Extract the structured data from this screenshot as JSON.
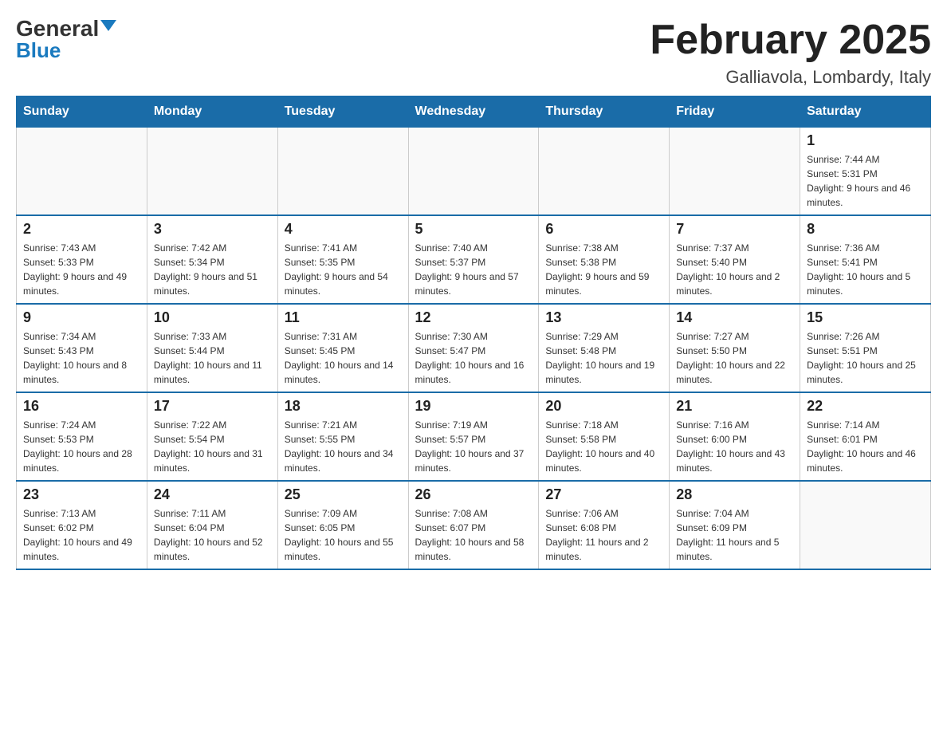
{
  "header": {
    "logo_general": "General",
    "logo_blue": "Blue",
    "month_title": "February 2025",
    "location": "Galliavola, Lombardy, Italy"
  },
  "days_of_week": [
    "Sunday",
    "Monday",
    "Tuesday",
    "Wednesday",
    "Thursday",
    "Friday",
    "Saturday"
  ],
  "weeks": [
    [
      {
        "day": "",
        "info": ""
      },
      {
        "day": "",
        "info": ""
      },
      {
        "day": "",
        "info": ""
      },
      {
        "day": "",
        "info": ""
      },
      {
        "day": "",
        "info": ""
      },
      {
        "day": "",
        "info": ""
      },
      {
        "day": "1",
        "info": "Sunrise: 7:44 AM\nSunset: 5:31 PM\nDaylight: 9 hours and 46 minutes."
      }
    ],
    [
      {
        "day": "2",
        "info": "Sunrise: 7:43 AM\nSunset: 5:33 PM\nDaylight: 9 hours and 49 minutes."
      },
      {
        "day": "3",
        "info": "Sunrise: 7:42 AM\nSunset: 5:34 PM\nDaylight: 9 hours and 51 minutes."
      },
      {
        "day": "4",
        "info": "Sunrise: 7:41 AM\nSunset: 5:35 PM\nDaylight: 9 hours and 54 minutes."
      },
      {
        "day": "5",
        "info": "Sunrise: 7:40 AM\nSunset: 5:37 PM\nDaylight: 9 hours and 57 minutes."
      },
      {
        "day": "6",
        "info": "Sunrise: 7:38 AM\nSunset: 5:38 PM\nDaylight: 9 hours and 59 minutes."
      },
      {
        "day": "7",
        "info": "Sunrise: 7:37 AM\nSunset: 5:40 PM\nDaylight: 10 hours and 2 minutes."
      },
      {
        "day": "8",
        "info": "Sunrise: 7:36 AM\nSunset: 5:41 PM\nDaylight: 10 hours and 5 minutes."
      }
    ],
    [
      {
        "day": "9",
        "info": "Sunrise: 7:34 AM\nSunset: 5:43 PM\nDaylight: 10 hours and 8 minutes."
      },
      {
        "day": "10",
        "info": "Sunrise: 7:33 AM\nSunset: 5:44 PM\nDaylight: 10 hours and 11 minutes."
      },
      {
        "day": "11",
        "info": "Sunrise: 7:31 AM\nSunset: 5:45 PM\nDaylight: 10 hours and 14 minutes."
      },
      {
        "day": "12",
        "info": "Sunrise: 7:30 AM\nSunset: 5:47 PM\nDaylight: 10 hours and 16 minutes."
      },
      {
        "day": "13",
        "info": "Sunrise: 7:29 AM\nSunset: 5:48 PM\nDaylight: 10 hours and 19 minutes."
      },
      {
        "day": "14",
        "info": "Sunrise: 7:27 AM\nSunset: 5:50 PM\nDaylight: 10 hours and 22 minutes."
      },
      {
        "day": "15",
        "info": "Sunrise: 7:26 AM\nSunset: 5:51 PM\nDaylight: 10 hours and 25 minutes."
      }
    ],
    [
      {
        "day": "16",
        "info": "Sunrise: 7:24 AM\nSunset: 5:53 PM\nDaylight: 10 hours and 28 minutes."
      },
      {
        "day": "17",
        "info": "Sunrise: 7:22 AM\nSunset: 5:54 PM\nDaylight: 10 hours and 31 minutes."
      },
      {
        "day": "18",
        "info": "Sunrise: 7:21 AM\nSunset: 5:55 PM\nDaylight: 10 hours and 34 minutes."
      },
      {
        "day": "19",
        "info": "Sunrise: 7:19 AM\nSunset: 5:57 PM\nDaylight: 10 hours and 37 minutes."
      },
      {
        "day": "20",
        "info": "Sunrise: 7:18 AM\nSunset: 5:58 PM\nDaylight: 10 hours and 40 minutes."
      },
      {
        "day": "21",
        "info": "Sunrise: 7:16 AM\nSunset: 6:00 PM\nDaylight: 10 hours and 43 minutes."
      },
      {
        "day": "22",
        "info": "Sunrise: 7:14 AM\nSunset: 6:01 PM\nDaylight: 10 hours and 46 minutes."
      }
    ],
    [
      {
        "day": "23",
        "info": "Sunrise: 7:13 AM\nSunset: 6:02 PM\nDaylight: 10 hours and 49 minutes."
      },
      {
        "day": "24",
        "info": "Sunrise: 7:11 AM\nSunset: 6:04 PM\nDaylight: 10 hours and 52 minutes."
      },
      {
        "day": "25",
        "info": "Sunrise: 7:09 AM\nSunset: 6:05 PM\nDaylight: 10 hours and 55 minutes."
      },
      {
        "day": "26",
        "info": "Sunrise: 7:08 AM\nSunset: 6:07 PM\nDaylight: 10 hours and 58 minutes."
      },
      {
        "day": "27",
        "info": "Sunrise: 7:06 AM\nSunset: 6:08 PM\nDaylight: 11 hours and 2 minutes."
      },
      {
        "day": "28",
        "info": "Sunrise: 7:04 AM\nSunset: 6:09 PM\nDaylight: 11 hours and 5 minutes."
      },
      {
        "day": "",
        "info": ""
      }
    ]
  ]
}
